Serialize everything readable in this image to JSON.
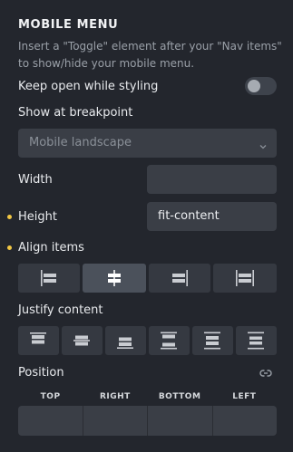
{
  "section": {
    "title": "MOBILE MENU",
    "description": "Insert a \"Toggle\" element after your \"Nav items\" to show/hide your mobile menu."
  },
  "keep_open": {
    "label": "Keep open while styling",
    "enabled": false
  },
  "breakpoint": {
    "label": "Show at breakpoint",
    "selected": "Mobile landscape"
  },
  "width": {
    "label": "Width",
    "value": ""
  },
  "height": {
    "label": "Height",
    "value": "fit-content",
    "modified": true
  },
  "align_items": {
    "label": "Align items",
    "modified": true,
    "options": [
      "align-start-icon",
      "align-center-icon",
      "align-end-icon",
      "align-stretch-icon"
    ],
    "selected_index": 1
  },
  "justify_content": {
    "label": "Justify content",
    "options": [
      "justify-start-icon",
      "justify-center-icon",
      "justify-end-icon",
      "justify-space-between-icon",
      "justify-space-around-icon",
      "justify-space-evenly-icon"
    ]
  },
  "position": {
    "label": "Position",
    "columns": [
      "TOP",
      "RIGHT",
      "BOTTOM",
      "LEFT"
    ]
  },
  "colors": {
    "background": "#23262d",
    "field": "#3a3e46",
    "modified_dot": "#f2c744"
  }
}
